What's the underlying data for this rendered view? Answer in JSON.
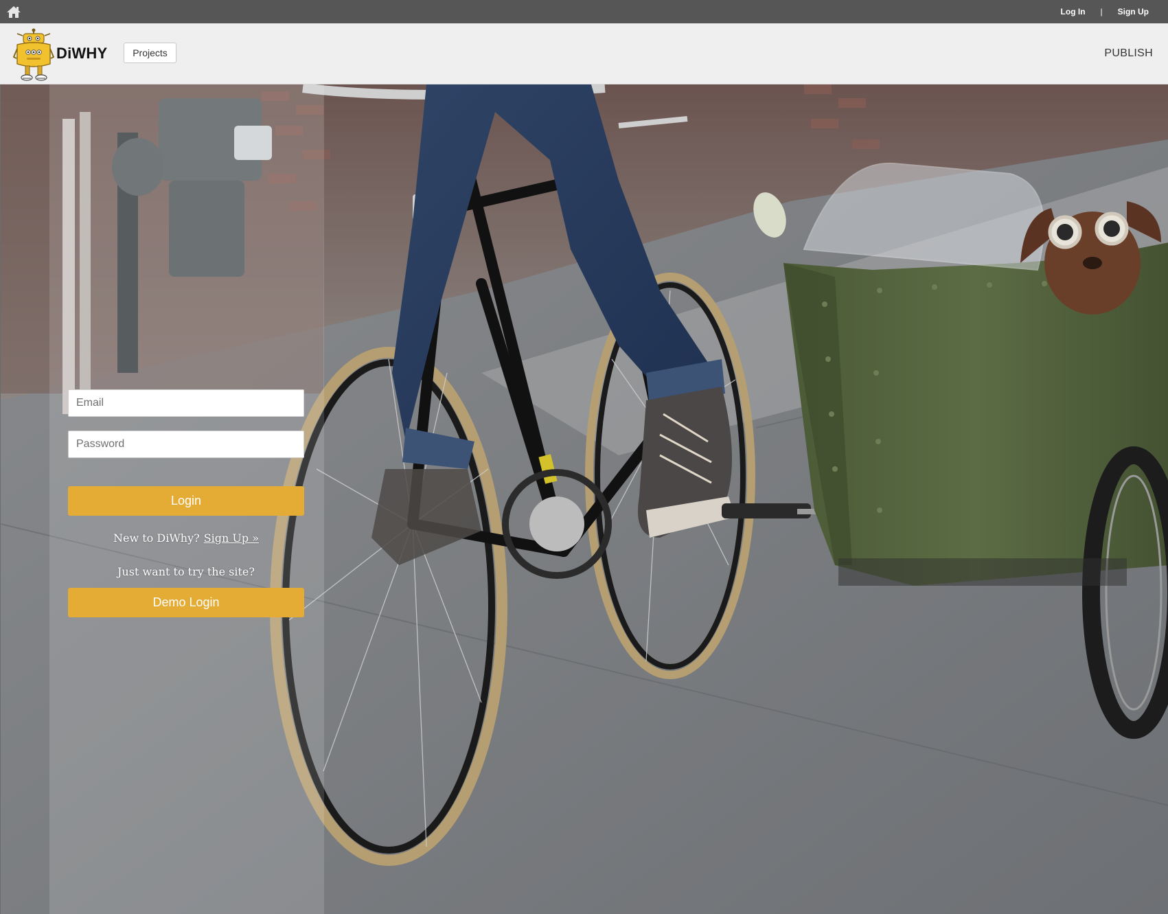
{
  "topbar": {
    "home_icon": "home-icon",
    "login_label": "Log In",
    "separator": "|",
    "signup_label": "Sign Up"
  },
  "header": {
    "logo_icon": "robot-mascot-icon",
    "brand": "DiWHY",
    "projects_label": "Projects",
    "publish_label": "PUBLISH"
  },
  "login": {
    "email_placeholder": "Email",
    "password_placeholder": "Password",
    "login_label": "Login",
    "new_prompt": "New to DiWhy?",
    "signup_link": "Sign Up »",
    "try_prompt": "Just want to try the site?",
    "demo_label": "Demo Login"
  },
  "colors": {
    "topbar": "#565656",
    "header": "#efefef",
    "accent": "#e4ab35",
    "logo_yellow": "#f2c12e"
  }
}
